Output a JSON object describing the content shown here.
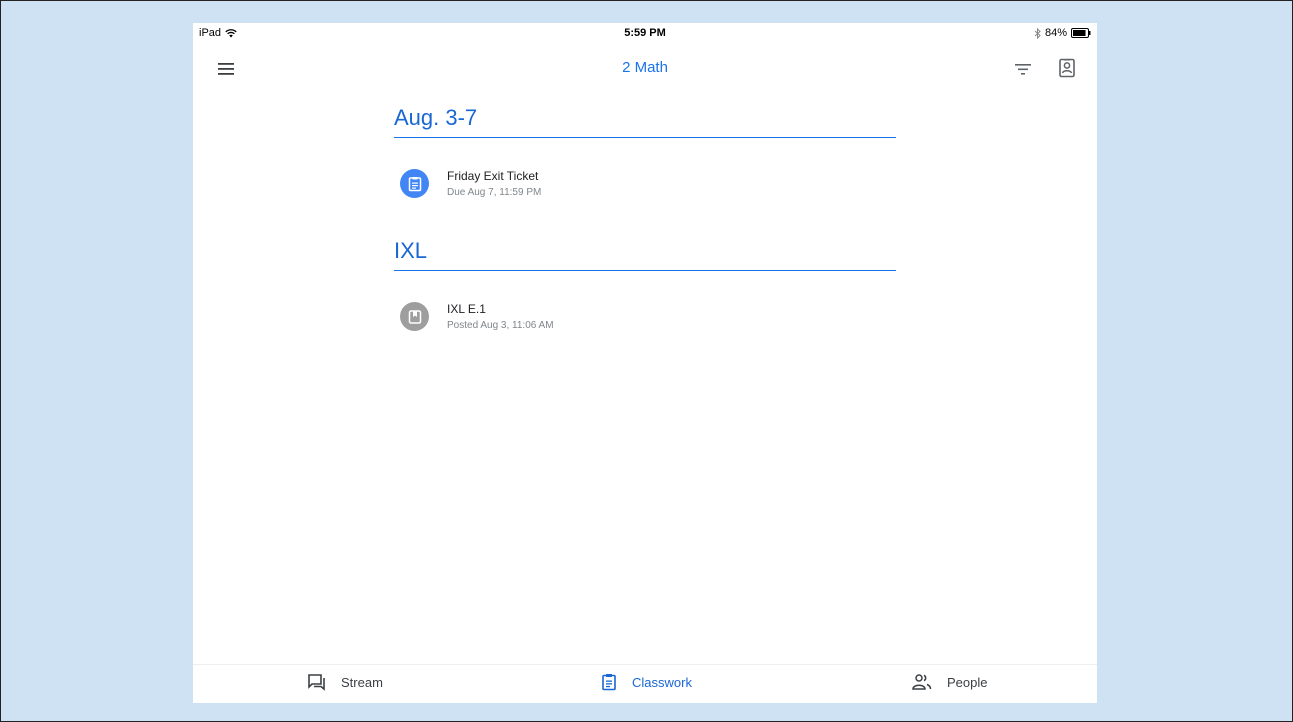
{
  "status_bar": {
    "device": "iPad",
    "time": "5:59 PM",
    "battery": "84%"
  },
  "app_bar": {
    "title": "2 Math"
  },
  "topics": [
    {
      "heading": "Aug. 3-7",
      "items": [
        {
          "name": "Friday Exit Ticket",
          "meta": "Due Aug 7, 11:59 PM",
          "icon": "assignment-icon",
          "color": "#4285f4"
        }
      ]
    },
    {
      "heading": "IXL",
      "items": [
        {
          "name": "IXL E.1",
          "meta": "Posted Aug 3, 11:06 AM",
          "icon": "material-icon",
          "color": "#9e9e9e"
        }
      ]
    }
  ],
  "bottom_nav": {
    "tabs": [
      {
        "label": "Stream",
        "icon": "stream-icon",
        "active": false
      },
      {
        "label": "Classwork",
        "icon": "classwork-icon",
        "active": true
      },
      {
        "label": "People",
        "icon": "people-icon",
        "active": false
      }
    ]
  },
  "colors": {
    "accent": "#1a73e8",
    "background": "#cfe2f3"
  }
}
